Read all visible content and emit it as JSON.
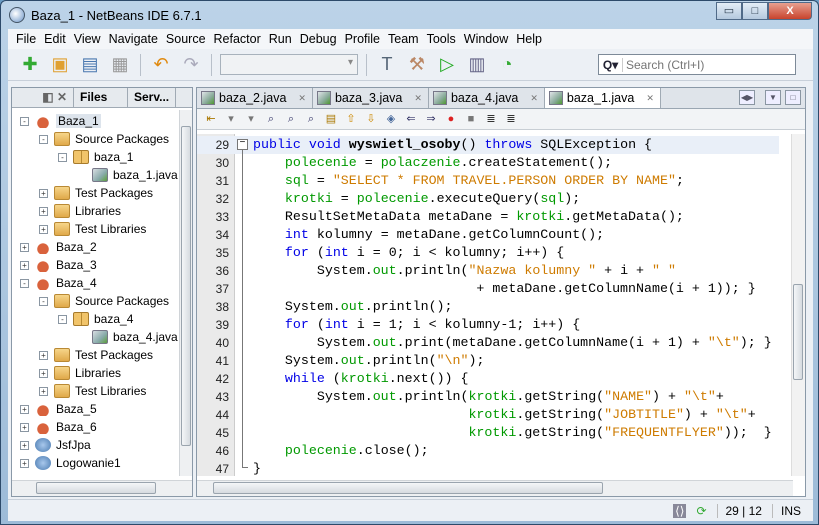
{
  "window": {
    "title": "Baza_1 - NetBeans IDE 6.7.1",
    "minimize": "▭",
    "maximize": "□",
    "close": "X"
  },
  "menu": [
    "File",
    "Edit",
    "View",
    "Navigate",
    "Source",
    "Refactor",
    "Run",
    "Debug",
    "Profile",
    "Team",
    "Tools",
    "Window",
    "Help"
  ],
  "toolbar": {
    "search_placeholder": "Search (Ctrl+I)",
    "config_value": ""
  },
  "left_panel": {
    "tabs": [
      "Files",
      "Serv..."
    ],
    "tree": [
      {
        "label": "Baza_1",
        "level": 0,
        "icon": "project",
        "toggle": "-"
      },
      {
        "label": "Source Packages",
        "level": 1,
        "icon": "folder",
        "toggle": "-"
      },
      {
        "label": "baza_1",
        "level": 2,
        "icon": "package",
        "toggle": "-"
      },
      {
        "label": "baza_1.java",
        "level": 3,
        "icon": "java-file",
        "toggle": ""
      },
      {
        "label": "Test Packages",
        "level": 1,
        "icon": "folder",
        "toggle": "+"
      },
      {
        "label": "Libraries",
        "level": 1,
        "icon": "folder",
        "toggle": "+"
      },
      {
        "label": "Test Libraries",
        "level": 1,
        "icon": "folder",
        "toggle": "+"
      },
      {
        "label": "Baza_2",
        "level": 0,
        "icon": "project",
        "toggle": "+"
      },
      {
        "label": "Baza_3",
        "level": 0,
        "icon": "project",
        "toggle": "+"
      },
      {
        "label": "Baza_4",
        "level": 0,
        "icon": "project",
        "toggle": "-"
      },
      {
        "label": "Source Packages",
        "level": 1,
        "icon": "folder",
        "toggle": "-"
      },
      {
        "label": "baza_4",
        "level": 2,
        "icon": "package",
        "toggle": "-"
      },
      {
        "label": "baza_4.java",
        "level": 3,
        "icon": "java-file",
        "toggle": ""
      },
      {
        "label": "Test Packages",
        "level": 1,
        "icon": "folder",
        "toggle": "+"
      },
      {
        "label": "Libraries",
        "level": 1,
        "icon": "folder",
        "toggle": "+"
      },
      {
        "label": "Test Libraries",
        "level": 1,
        "icon": "folder",
        "toggle": "+"
      },
      {
        "label": "Baza_5",
        "level": 0,
        "icon": "project",
        "toggle": "+"
      },
      {
        "label": "Baza_6",
        "level": 0,
        "icon": "project",
        "toggle": "+"
      },
      {
        "label": "JsfJpa",
        "level": 0,
        "icon": "web-project",
        "toggle": "+"
      },
      {
        "label": "Logowanie1",
        "level": 0,
        "icon": "web-project",
        "toggle": "+"
      }
    ]
  },
  "editor": {
    "tabs": [
      {
        "label": "baza_2.java",
        "active": false
      },
      {
        "label": "baza_3.java",
        "active": false
      },
      {
        "label": "baza_4.java",
        "active": false
      },
      {
        "label": "baza_1.java",
        "active": true
      }
    ],
    "colors": {
      "keyword": "#0000e6",
      "field": "#009900",
      "string": "#ce7b00",
      "current_line": "#e9eff8"
    },
    "lines": [
      {
        "n": "29",
        "t": [
          [
            "k",
            "public void "
          ],
          [
            "b",
            "wyswietl_osoby"
          ],
          [
            "p",
            "() "
          ],
          [
            "k",
            "throws"
          ],
          [
            "p",
            " SQLException {"
          ]
        ]
      },
      {
        "n": "30",
        "t": [
          [
            "p",
            "    "
          ],
          [
            "f",
            "polecenie"
          ],
          [
            "p",
            " = "
          ],
          [
            "f",
            "polaczenie"
          ],
          [
            "p",
            ".createStatement();"
          ]
        ]
      },
      {
        "n": "31",
        "t": [
          [
            "p",
            "    "
          ],
          [
            "f",
            "sql"
          ],
          [
            "p",
            " = "
          ],
          [
            "s",
            "\"SELECT * FROM TRAVEL.PERSON ORDER BY NAME\""
          ],
          [
            "p",
            ";"
          ]
        ]
      },
      {
        "n": "32",
        "t": [
          [
            "p",
            "    "
          ],
          [
            "f",
            "krotki"
          ],
          [
            "p",
            " = "
          ],
          [
            "f",
            "polecenie"
          ],
          [
            "p",
            ".executeQuery("
          ],
          [
            "f",
            "sql"
          ],
          [
            "p",
            ");"
          ]
        ]
      },
      {
        "n": "33",
        "t": [
          [
            "p",
            "    ResultSetMetaData metaDane = "
          ],
          [
            "f",
            "krotki"
          ],
          [
            "p",
            ".getMetaData();"
          ]
        ]
      },
      {
        "n": "34",
        "t": [
          [
            "p",
            "    "
          ],
          [
            "k",
            "int"
          ],
          [
            "p",
            " kolumny = metaDane.getColumnCount();"
          ]
        ]
      },
      {
        "n": "35",
        "t": [
          [
            "p",
            "    "
          ],
          [
            "k",
            "for"
          ],
          [
            "p",
            " ("
          ],
          [
            "k",
            "int"
          ],
          [
            "p",
            " i = 0; i < kolumny; i++) {"
          ]
        ]
      },
      {
        "n": "36",
        "t": [
          [
            "p",
            "        System."
          ],
          [
            "f",
            "out"
          ],
          [
            "p",
            ".println("
          ],
          [
            "s",
            "\"Nazwa kolumny \""
          ],
          [
            "p",
            " + i + "
          ],
          [
            "s",
            "\" \""
          ]
        ]
      },
      {
        "n": "37",
        "t": [
          [
            "p",
            "                            + metaDane.getColumnName(i + 1)); }"
          ]
        ]
      },
      {
        "n": "38",
        "t": [
          [
            "p",
            "    System."
          ],
          [
            "f",
            "out"
          ],
          [
            "p",
            ".println();"
          ]
        ]
      },
      {
        "n": "39",
        "t": [
          [
            "p",
            "    "
          ],
          [
            "k",
            "for"
          ],
          [
            "p",
            " ("
          ],
          [
            "k",
            "int"
          ],
          [
            "p",
            " i = 1; i < kolumny-1; i++) {"
          ]
        ]
      },
      {
        "n": "40",
        "t": [
          [
            "p",
            "        System."
          ],
          [
            "f",
            "out"
          ],
          [
            "p",
            ".print(metaDane.getColumnName(i + 1) + "
          ],
          [
            "s",
            "\"\\t\""
          ],
          [
            "p",
            "); }"
          ]
        ]
      },
      {
        "n": "41",
        "t": [
          [
            "p",
            "    System."
          ],
          [
            "f",
            "out"
          ],
          [
            "p",
            ".println("
          ],
          [
            "s",
            "\"\\n\""
          ],
          [
            "p",
            ");"
          ]
        ]
      },
      {
        "n": "42",
        "t": [
          [
            "p",
            "    "
          ],
          [
            "k",
            "while"
          ],
          [
            "p",
            " ("
          ],
          [
            "f",
            "krotki"
          ],
          [
            "p",
            ".next()) {"
          ]
        ]
      },
      {
        "n": "43",
        "t": [
          [
            "p",
            "        System."
          ],
          [
            "f",
            "out"
          ],
          [
            "p",
            ".println("
          ],
          [
            "f",
            "krotki"
          ],
          [
            "p",
            ".getString("
          ],
          [
            "s",
            "\"NAME\""
          ],
          [
            "p",
            ") + "
          ],
          [
            "s",
            "\"\\t\""
          ],
          [
            "p",
            "+"
          ]
        ]
      },
      {
        "n": "44",
        "t": [
          [
            "p",
            "                           "
          ],
          [
            "f",
            "krotki"
          ],
          [
            "p",
            ".getString("
          ],
          [
            "s",
            "\"JOBTITLE\""
          ],
          [
            "p",
            ") + "
          ],
          [
            "s",
            "\"\\t\""
          ],
          [
            "p",
            "+"
          ]
        ]
      },
      {
        "n": "45",
        "t": [
          [
            "p",
            "                           "
          ],
          [
            "f",
            "krotki"
          ],
          [
            "p",
            ".getString("
          ],
          [
            "s",
            "\"FREQUENTFLYER\""
          ],
          [
            "p",
            "));  }"
          ]
        ]
      },
      {
        "n": "46",
        "t": [
          [
            "p",
            "    "
          ],
          [
            "f",
            "polecenie"
          ],
          [
            "p",
            ".close();"
          ]
        ]
      },
      {
        "n": "47",
        "t": [
          [
            "p",
            "}"
          ]
        ]
      }
    ]
  },
  "status": {
    "position": "29 | 12",
    "mode": "INS"
  }
}
